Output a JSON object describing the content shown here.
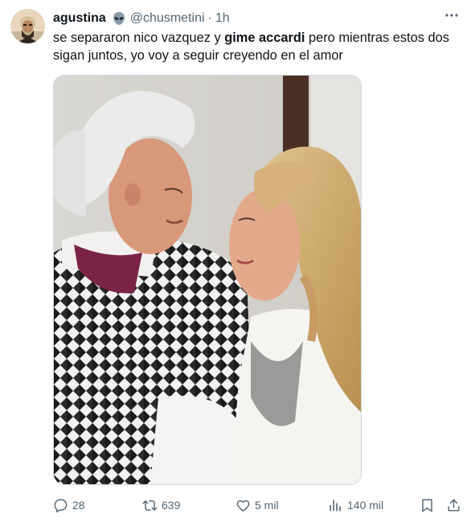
{
  "tweet": {
    "author": {
      "name": "agustina",
      "name_emoji_icon": "alien-emoji-icon",
      "handle": "@chusmetini",
      "separator": "·",
      "time": "1h"
    },
    "text_parts": {
      "p1": "se separaron nico vazquez y ",
      "p2_bold": "gime accardi",
      "p3": " pero mientras estos dos sigan juntos, yo voy a seguir creyendo en el amor"
    },
    "media": {
      "icon": "photo-couple-image"
    },
    "actions": {
      "replies": "28",
      "retweets": "639",
      "likes": "5 mil",
      "views": "140 mil"
    },
    "colors": {
      "text": "#0f1419",
      "secondary": "#536471",
      "border": "#cfd9de"
    }
  }
}
